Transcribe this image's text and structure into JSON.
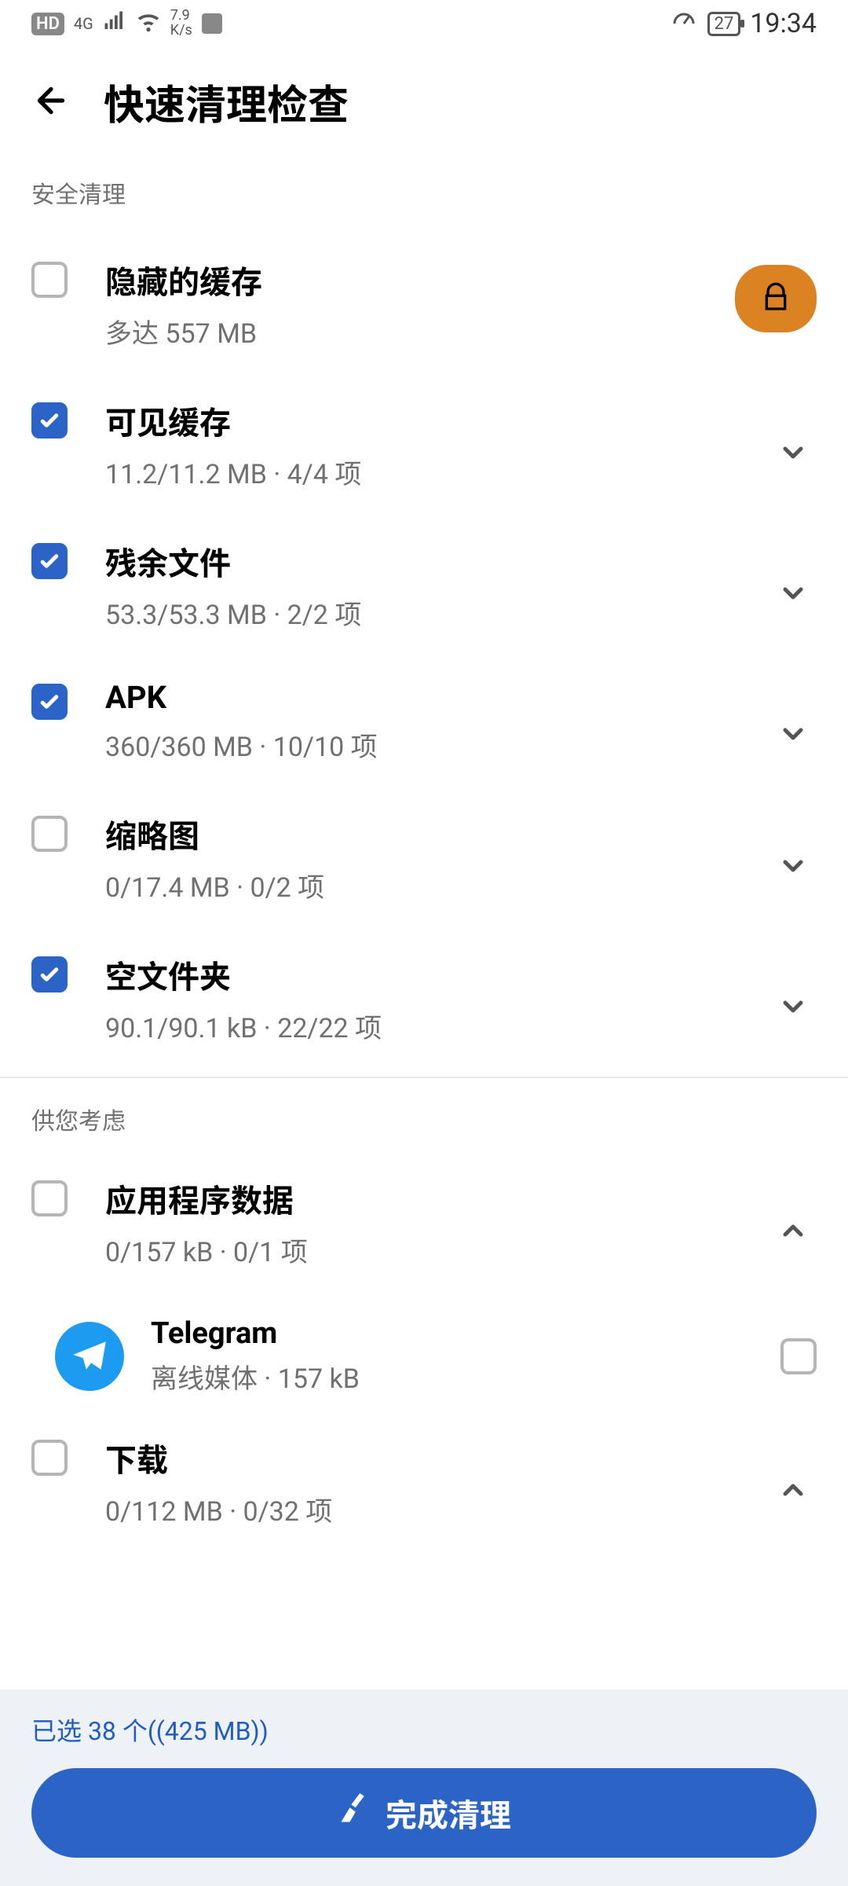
{
  "status": {
    "hd": "HD",
    "speed_line1": "7.9",
    "speed_line2": "K/s",
    "battery": "27",
    "time": "19:34"
  },
  "header": {
    "title": "快速清理检查"
  },
  "sections": {
    "safe_clean": "安全清理",
    "consider": "供您考虑"
  },
  "items": {
    "hidden_cache": {
      "title": "隐藏的缓存",
      "sub": "多达 557 MB"
    },
    "visible_cache": {
      "title": "可见缓存",
      "sub": "11.2/11.2 MB · 4/4 项"
    },
    "residual": {
      "title": "残余文件",
      "sub": "53.3/53.3 MB · 2/2 项"
    },
    "apk": {
      "title": "APK",
      "sub": "360/360 MB · 10/10 项"
    },
    "thumbs": {
      "title": "缩略图",
      "sub": "0/17.4 MB · 0/2 项"
    },
    "empty_folders": {
      "title": "空文件夹",
      "sub": "90.1/90.1 kB · 22/22 项"
    },
    "app_data": {
      "title": "应用程序数据",
      "sub": "0/157 kB · 0/1 项"
    },
    "telegram": {
      "title": "Telegram",
      "sub": "离线媒体 · 157 kB"
    },
    "downloads": {
      "title": "下载",
      "sub": "0/112 MB · 0/32 项"
    }
  },
  "bottom": {
    "selection": "已选 38 个((425 MB))",
    "button": "完成清理"
  }
}
